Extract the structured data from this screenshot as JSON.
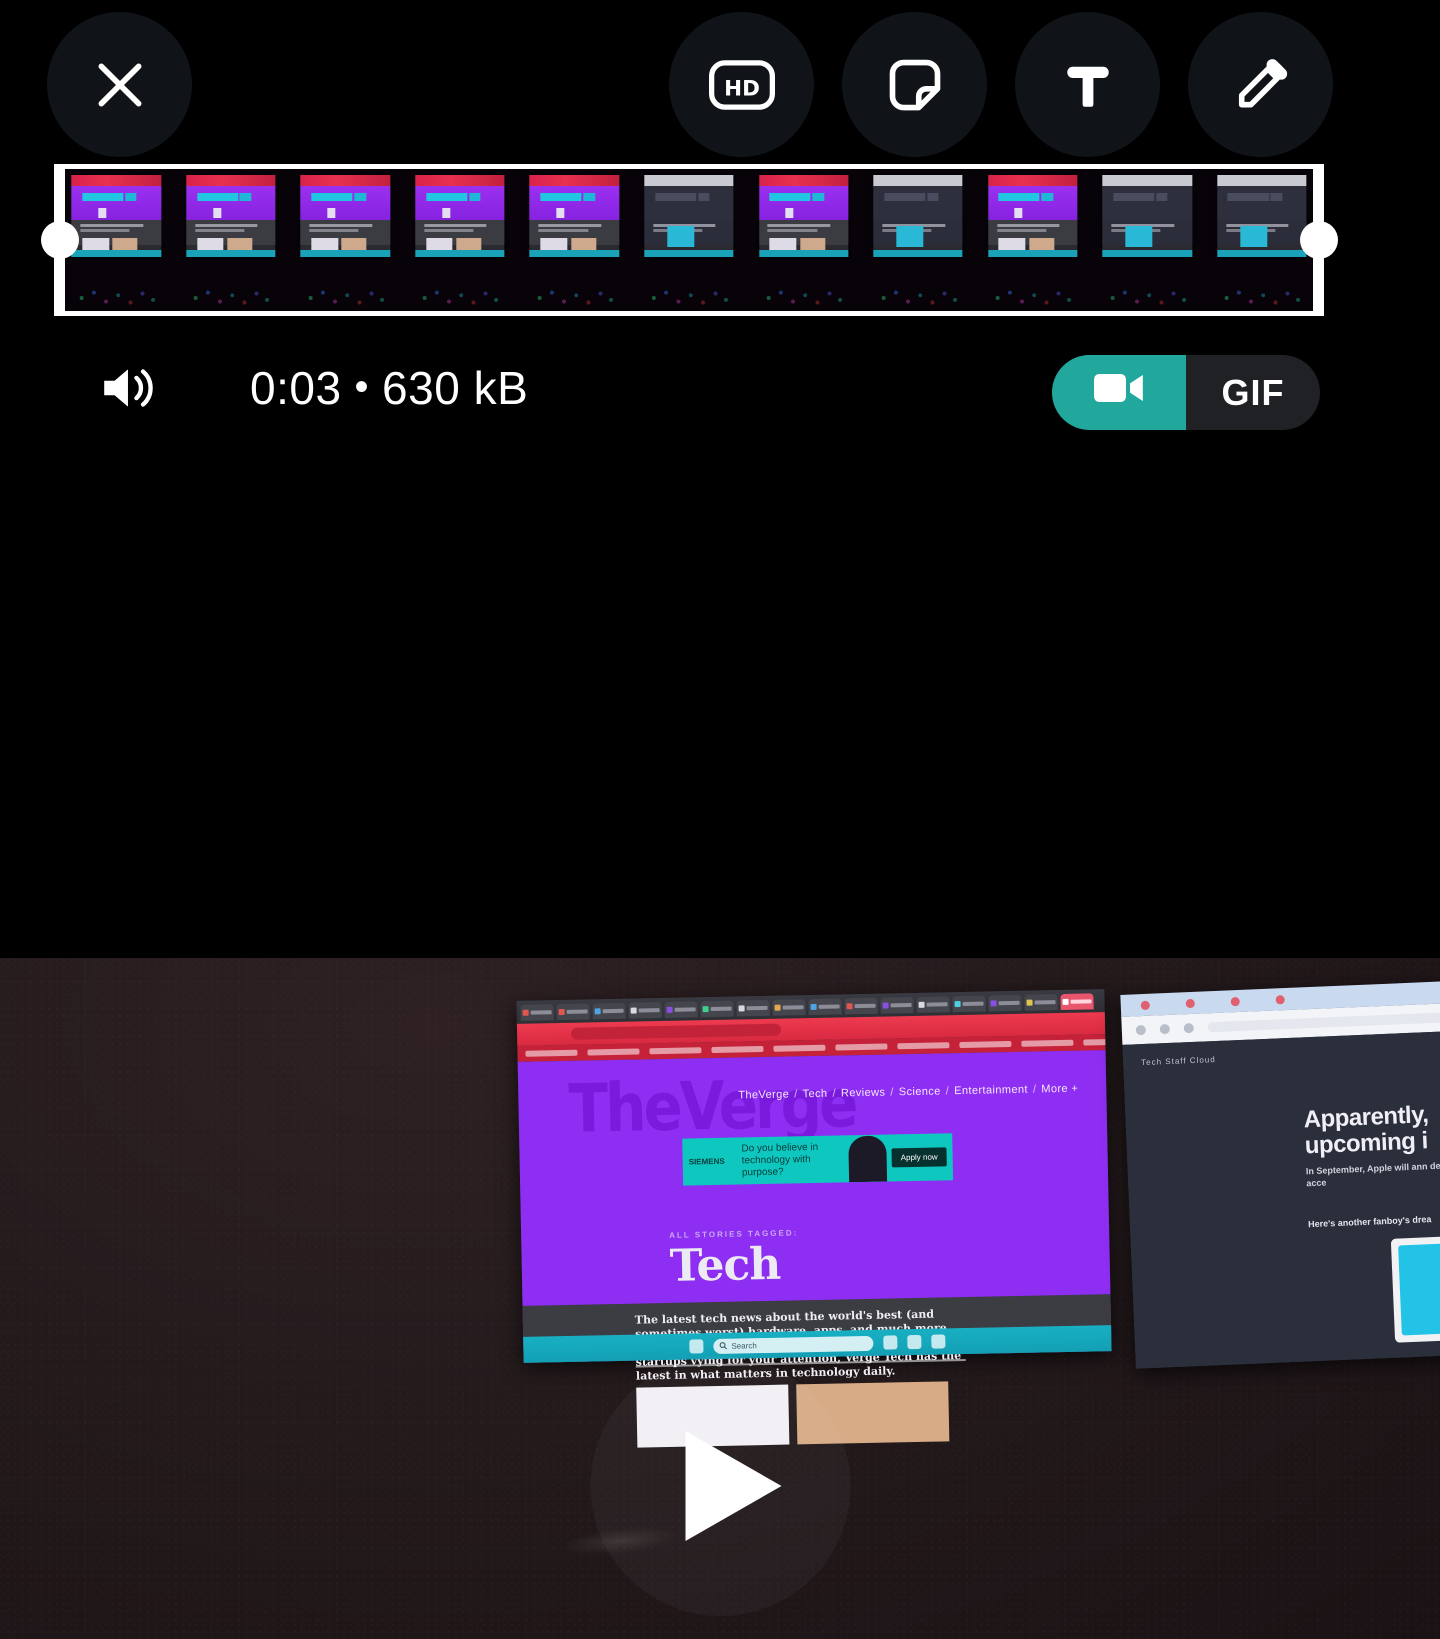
{
  "screen": {
    "app": "media-editor",
    "background_color": "#000000",
    "accent_color": "#21A79C"
  },
  "toolbar": {
    "close_label": "close-icon",
    "actions": [
      {
        "name": "hd-quality",
        "label": "HD",
        "icon": "hd-icon"
      },
      {
        "name": "sticker",
        "label": "",
        "icon": "sticker-icon"
      },
      {
        "name": "text",
        "label": "T",
        "icon": "text-icon"
      },
      {
        "name": "draw",
        "label": "",
        "icon": "pencil-icon"
      }
    ]
  },
  "trimmer": {
    "frame_count": 11,
    "left_handle": "trim-start-handle",
    "right_handle": "trim-end-handle"
  },
  "meta": {
    "audio_icon": "speaker-on-icon",
    "duration": "0:03",
    "separator": "•",
    "size": "630 kB"
  },
  "format_toggle": {
    "selected": "video",
    "video_label": "",
    "video_icon": "video-camera-icon",
    "gif_label": "GIF"
  },
  "preview": {
    "play_button": "play-icon",
    "left_monitor": {
      "site_ghost": "TheVerge",
      "nav": [
        "TheVerge",
        "Tech",
        "Reviews",
        "Science",
        "Entertainment",
        "More +"
      ],
      "ad": {
        "brand": "SIEMENS",
        "copy": "Do you believe in technology with purpose?",
        "cta": "Apply now"
      },
      "kicker": "ALL STORIES TAGGED:",
      "title": "Tech",
      "body": "The latest tech news about the world's best (and sometimes worst) hardware, apps, and much more. From top companies like Google and Apple to tiny startups vying for your attention, Verge Tech has the latest in what matters in technology daily.",
      "taskbar_search": "Search"
    },
    "right_monitor": {
      "breadcrumb": "Tech  Staff  Cloud",
      "headline": "Apparently, upcoming i",
      "subhead": "In September, Apple will ann decision) among us with acce",
      "kicker": "Here's another fanboy's drea"
    }
  }
}
